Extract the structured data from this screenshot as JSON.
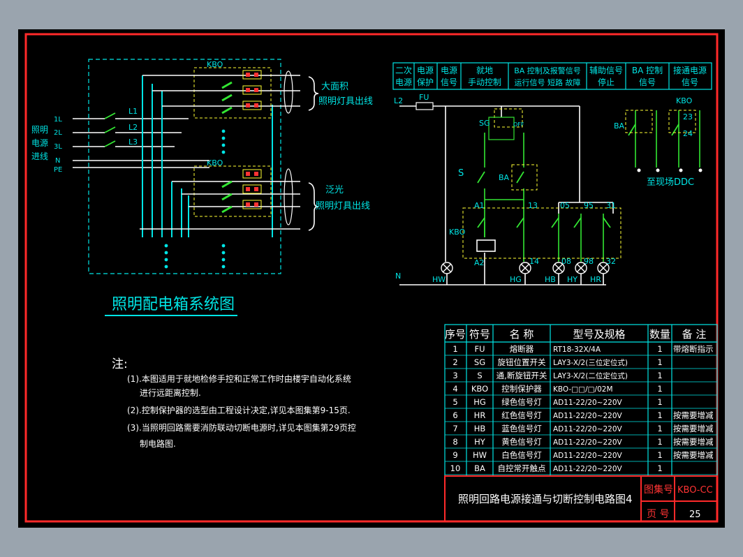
{
  "colors": {
    "background": "#000000",
    "frame": "#ff2a2a",
    "cyan": "#00e5e5",
    "green": "#33e633",
    "white": "#ffffff",
    "yellow": "#ffff33",
    "red": "#ff3333",
    "olive": "#c8c83c"
  },
  "left": {
    "kbo_label_top": "KBO",
    "kbo_label_mid": "KBO",
    "power_in": [
      "照明",
      "电源",
      "进线"
    ],
    "phases_left": [
      "1L",
      "2L",
      "3L",
      "N",
      "PE"
    ],
    "phases_right": [
      "L1",
      "L2",
      "L3"
    ],
    "outlet_large": [
      "大面积",
      "照明灯具出线"
    ],
    "outlet_flood": [
      "泛光",
      "照明灯具出线"
    ],
    "title": "照明配电箱系统图"
  },
  "notes": {
    "heading": "注:",
    "lines": [
      "(1).本图适用于就地检修手控和正常工作时由楼宇自动化系统",
      "进行远距离控制.",
      "(2).控制保护器的选型由工程设计决定,详见本图集第9-15页.",
      "(3).当照明回路需要消防联动切断电源时,详见本图集第29页控",
      "制电路图."
    ]
  },
  "right": {
    "header_cells": [
      [
        "二次",
        "电源"
      ],
      [
        "电源",
        "保护"
      ],
      [
        "电源",
        "信号"
      ],
      [
        "就地",
        "手动控制"
      ],
      [
        "BA 控制及报警信号",
        "运行信号 短路 故障"
      ],
      [
        "辅助信号",
        "停止"
      ],
      [
        "BA 控制",
        "信号"
      ],
      [
        "接通电源",
        "信号"
      ]
    ],
    "labels": {
      "l2": "L2",
      "fu": "FU",
      "sg": "SG",
      "off": "OFF",
      "s": "S",
      "ba1": "BA",
      "ba2": "BA",
      "kbo_top": "KBO",
      "t23": "23",
      "t24": "24",
      "ddc": "至现场DDC",
      "a1": "A1",
      "t13": "13",
      "t05": "05",
      "t95": "95",
      "t31": "31",
      "kbo_coil": "KBO",
      "a2": "A2",
      "t14": "14",
      "t08": "08",
      "t98": "98",
      "t32": "32",
      "n": "N",
      "hw": "HW",
      "hg": "HG",
      "hb": "HB",
      "hy": "HY",
      "hr": "HR"
    }
  },
  "table": {
    "headers": [
      "序号",
      "符号",
      "名 称",
      "型号及规格",
      "数量",
      "备 注"
    ],
    "rows": [
      [
        "1",
        "FU",
        "熔断器",
        "RT18-32X/4A",
        "1",
        "带熔断指示"
      ],
      [
        "2",
        "SG",
        "旋钮位置开关",
        "LAY3-X/2(三位定位式)",
        "1",
        ""
      ],
      [
        "3",
        "S",
        "通,断旋钮开关",
        "LAY3-X/2(二位定位式)",
        "1",
        ""
      ],
      [
        "4",
        "KBO",
        "控制保护器",
        "KBO-□□/□/02M",
        "1",
        ""
      ],
      [
        "5",
        "HG",
        "绿色信号灯",
        "AD11-22/20~220V",
        "1",
        ""
      ],
      [
        "6",
        "HR",
        "红色信号灯",
        "AD11-22/20~220V",
        "1",
        "按需要增减"
      ],
      [
        "7",
        "HB",
        "蓝色信号灯",
        "AD11-22/20~220V",
        "1",
        "按需要增减"
      ],
      [
        "8",
        "HY",
        "黄色信号灯",
        "AD11-22/20~220V",
        "1",
        "按需要增减"
      ],
      [
        "9",
        "HW",
        "白色信号灯",
        "AD11-22/20~220V",
        "1",
        "按需要增减"
      ],
      [
        "10",
        "BA",
        "自控常开触点",
        "AD11-22/20~220V",
        "1",
        ""
      ]
    ]
  },
  "titleblock": {
    "title": "照明回路电源接通与切断控制电路图4",
    "atlas_label": "图集号",
    "atlas_value": "KBO-CC",
    "page_label": "页 号",
    "page_value": "25"
  }
}
